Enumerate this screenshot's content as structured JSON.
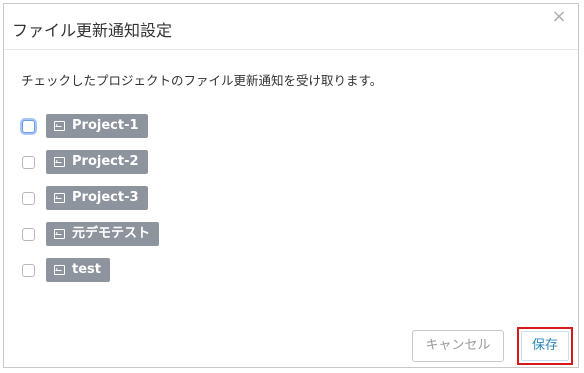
{
  "dialog": {
    "title": "ファイル更新通知設定",
    "close_glyph": "×",
    "description": "チェックしたプロジェクトのファイル更新通知を受け取ります。"
  },
  "projects": [
    {
      "label": "Project-1",
      "checked": false,
      "icon": "project-icon"
    },
    {
      "label": "Project-2",
      "checked": false,
      "icon": "project-icon"
    },
    {
      "label": "Project-3",
      "checked": false,
      "icon": "project-icon"
    },
    {
      "label": "元デモテスト",
      "checked": false,
      "icon": "project-icon"
    },
    {
      "label": "test",
      "checked": false,
      "icon": "project-icon"
    }
  ],
  "buttons": {
    "cancel_label": "キャンセル",
    "save_label": "保存"
  },
  "colors": {
    "tag_background": "#8e949d",
    "save_text": "#2a87b8",
    "highlight_border": "#d7191c"
  }
}
